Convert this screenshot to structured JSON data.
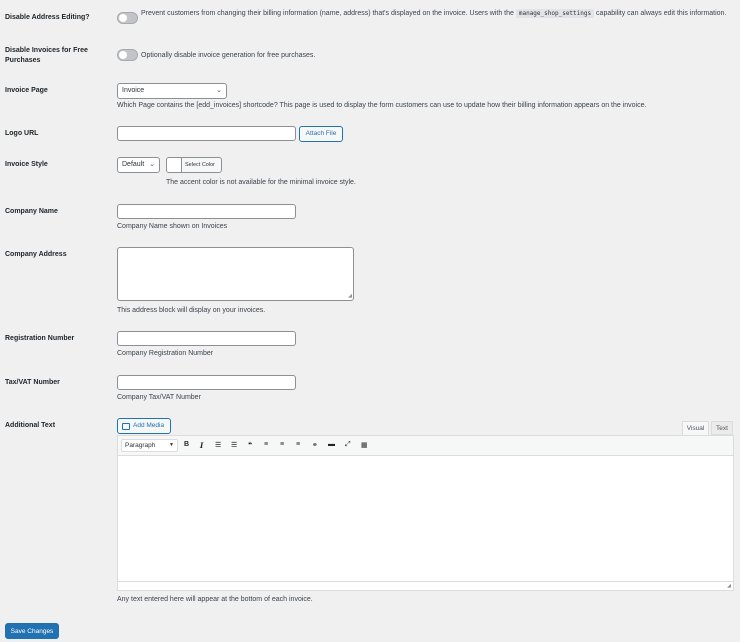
{
  "fields": {
    "disable_address": {
      "label": "Disable Address Editing?",
      "desc_before": "Prevent customers from changing their billing information (name, address) that's displayed on the invoice. Users with the ",
      "code": "manage_shop_settings",
      "desc_after": " capability can always edit this information."
    },
    "disable_free": {
      "label_line1": "Disable Invoices for Free",
      "label_line2": "Purchases",
      "desc": "Optionally disable invoice generation for free purchases."
    },
    "invoice_page": {
      "label": "Invoice Page",
      "value": "Invoice",
      "desc": "Which Page contains the [edd_invoices] shortcode? This page is used to display the form customers can use to update how their billing information appears on the invoice."
    },
    "logo_url": {
      "label": "Logo URL",
      "value": "",
      "button": "Attach File"
    },
    "invoice_style": {
      "label": "Invoice Style",
      "value": "Default",
      "color_button": "Select Color",
      "desc": "The accent color is not available for the minimal invoice style."
    },
    "company_name": {
      "label": "Company Name",
      "value": "",
      "desc": "Company Name shown on Invoices"
    },
    "company_address": {
      "label": "Company Address",
      "value": "",
      "desc": "This address block will display on your invoices."
    },
    "registration_number": {
      "label": "Registration Number",
      "value": "",
      "desc": "Company Registration Number"
    },
    "tax_vat": {
      "label": "Tax/VAT Number",
      "value": "",
      "desc": "Company Tax/VAT Number"
    },
    "additional_text": {
      "label": "Additional Text",
      "add_media": "Add Media",
      "tab_visual": "Visual",
      "tab_text": "Text",
      "format": "Paragraph",
      "desc": "Any text entered here will appear at the bottom of each invoice."
    }
  },
  "save_button": "Save Changes",
  "colors": {
    "accent": "#2271b1",
    "background": "#f0f0f1"
  }
}
